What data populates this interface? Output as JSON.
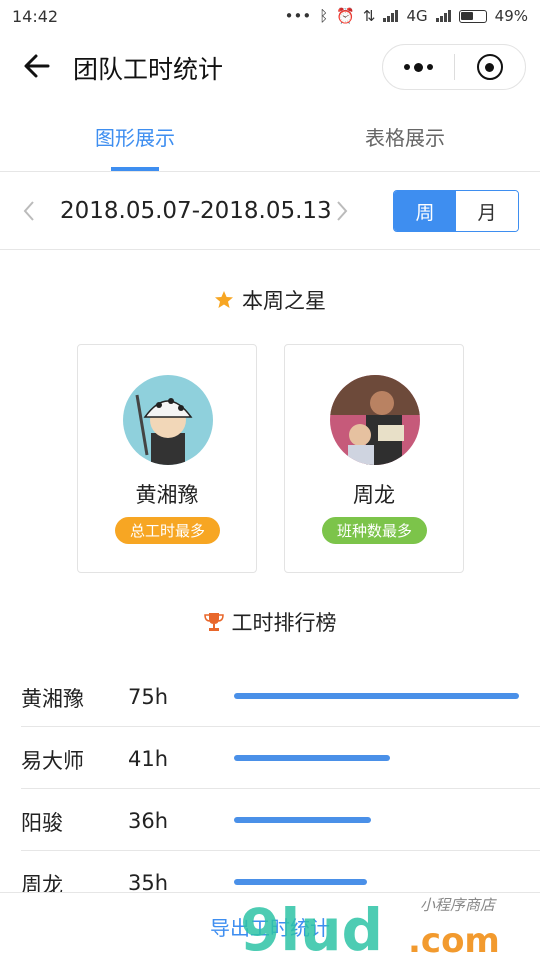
{
  "status": {
    "time": "14:42",
    "network": "4G",
    "battery": "49%"
  },
  "nav": {
    "title": "团队工时统计"
  },
  "tabs": [
    {
      "label": "图形展示",
      "active": true
    },
    {
      "label": "表格展示",
      "active": false
    }
  ],
  "date": {
    "range": "2018.05.07-2018.05.13",
    "toggle": [
      {
        "label": "周",
        "active": true
      },
      {
        "label": "月",
        "active": false
      }
    ]
  },
  "stars": {
    "title": "本周之星",
    "cards": [
      {
        "name": "黄湘豫",
        "badge": "总工时最多",
        "badge_color": "#f7a623"
      },
      {
        "name": "周龙",
        "badge": "班种数最多",
        "badge_color": "#7cc44a"
      }
    ]
  },
  "ranking": {
    "title": "工时排行榜",
    "max": 75,
    "rows": [
      {
        "name": "黄湘豫",
        "hours": "75h",
        "value": 75
      },
      {
        "name": "易大师",
        "hours": "41h",
        "value": 41
      },
      {
        "name": "阳骏",
        "hours": "36h",
        "value": 36
      },
      {
        "name": "周龙",
        "hours": "35h",
        "value": 35
      }
    ]
  },
  "footer": {
    "export_label": "导出工时统计"
  },
  "watermark": {
    "brand": "9lud",
    "domain": ".com",
    "tagline": "小程序商店"
  },
  "colors": {
    "accent": "#3e8ef0",
    "bar": "#4a90e8",
    "orange": "#f7a623",
    "green": "#7cc44a"
  }
}
